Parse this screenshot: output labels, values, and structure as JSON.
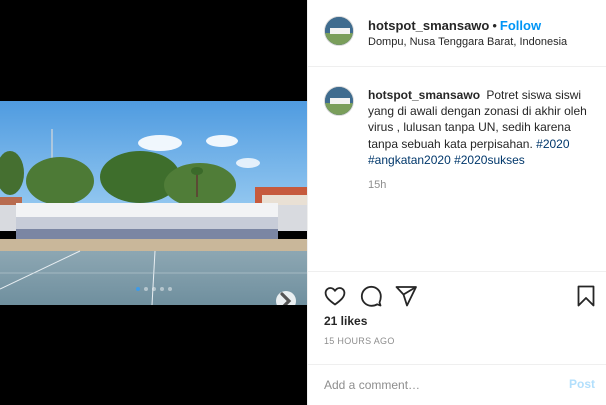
{
  "post": {
    "username": "hotspot_smansawo",
    "separator": "•",
    "follow_label": "Follow",
    "location": "Dompu, Nusa Tenggara Barat, Indonesia"
  },
  "caption": {
    "username": "hotspot_smansawo",
    "text": "Potret siswa siswi yang di awali dengan zonasi di akhir oleh virus , lulusan tanpa UN, sedih karena tanpa sebuah kata perpisahan.",
    "hashtags": "#2020 #angkatan2020 #2020sukses",
    "time": "15h"
  },
  "actions": {
    "icons": [
      "heart-icon",
      "comment-icon",
      "share-icon",
      "bookmark-icon"
    ],
    "likes": "21 likes",
    "timestamp": "15 HOURS AGO"
  },
  "comment_box": {
    "placeholder": "Add a comment…",
    "post_label": "Post"
  },
  "carousel": {
    "slide_count": 5,
    "active_index": 0
  },
  "colors": {
    "accent": "#0095f6",
    "post_disabled": "#b2dffc",
    "muted": "#8e8e8e"
  }
}
